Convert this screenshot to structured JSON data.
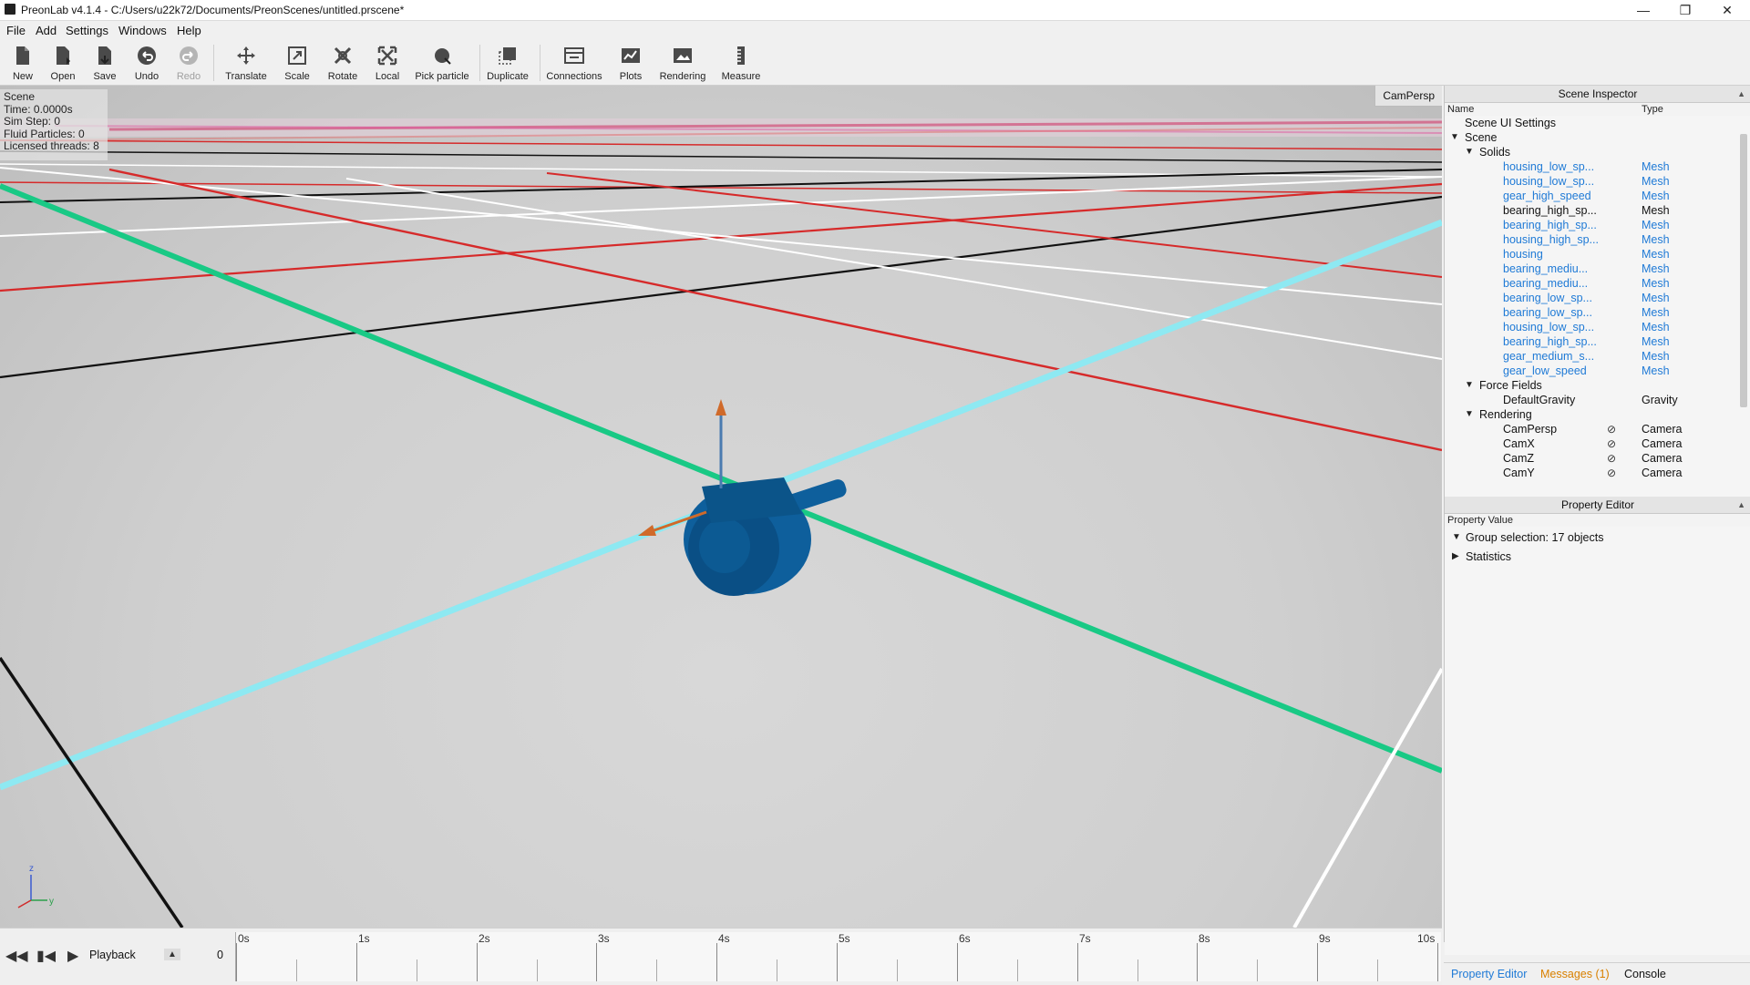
{
  "window": {
    "title": "PreonLab v4.1.4 - C:/Users/u22k72/Documents/PreonScenes/untitled.prscene*",
    "minimize": "—",
    "restore": "❐",
    "close": "✕"
  },
  "menu": [
    "File",
    "Add",
    "Settings",
    "Windows",
    "Help"
  ],
  "toolbar": [
    {
      "label": "New",
      "icon": "new-file-icon"
    },
    {
      "label": "Open",
      "icon": "open-file-icon"
    },
    {
      "label": "Save",
      "icon": "save-icon"
    },
    {
      "label": "Undo",
      "icon": "undo-icon"
    },
    {
      "label": "Redo",
      "icon": "redo-icon"
    },
    {
      "label": "Translate",
      "icon": "translate-icon"
    },
    {
      "label": "Scale",
      "icon": "scale-icon"
    },
    {
      "label": "Rotate",
      "icon": "rotate-icon"
    },
    {
      "label": "Local",
      "icon": "local-icon"
    },
    {
      "label": "Pick particle",
      "icon": "pick-particle-icon"
    },
    {
      "label": "Duplicate",
      "icon": "duplicate-icon"
    },
    {
      "label": "Connections",
      "icon": "connections-icon"
    },
    {
      "label": "Plots",
      "icon": "plots-icon"
    },
    {
      "label": "Rendering",
      "icon": "rendering-icon"
    },
    {
      "label": "Measure",
      "icon": "measure-icon"
    }
  ],
  "viewport": {
    "stats": [
      "Scene",
      "Time: 0.0000s",
      "Sim Step: 0",
      "Fluid Particles: 0",
      "Licensed threads: 8"
    ],
    "camera": "CamPersp",
    "gizmo": {
      "z": "z",
      "y": "y"
    }
  },
  "scene_inspector": {
    "title": "Scene Inspector",
    "col_name": "Name",
    "col_type": "Type",
    "rows": [
      {
        "name": "Scene UI Settings",
        "type": "",
        "level": 1,
        "arrow": "",
        "color": "normal"
      },
      {
        "name": "Scene",
        "type": "",
        "level": 1,
        "arrow": "down",
        "color": "normal"
      },
      {
        "name": "Solids",
        "type": "",
        "level": 2,
        "arrow": "down",
        "color": "normal"
      },
      {
        "name": "housing_low_sp...",
        "type": "Mesh",
        "level": 3,
        "arrow": "",
        "color": "blue"
      },
      {
        "name": "housing_low_sp...",
        "type": "Mesh",
        "level": 3,
        "arrow": "",
        "color": "blue"
      },
      {
        "name": "gear_high_speed",
        "type": "Mesh",
        "level": 3,
        "arrow": "",
        "color": "blue"
      },
      {
        "name": "bearing_high_sp...",
        "type": "Mesh",
        "level": 3,
        "arrow": "",
        "color": "normal"
      },
      {
        "name": "bearing_high_sp...",
        "type": "Mesh",
        "level": 3,
        "arrow": "",
        "color": "blue"
      },
      {
        "name": "housing_high_sp...",
        "type": "Mesh",
        "level": 3,
        "arrow": "",
        "color": "blue"
      },
      {
        "name": "housing",
        "type": "Mesh",
        "level": 3,
        "arrow": "",
        "color": "blue"
      },
      {
        "name": "bearing_mediu...",
        "type": "Mesh",
        "level": 3,
        "arrow": "",
        "color": "blue"
      },
      {
        "name": "bearing_mediu...",
        "type": "Mesh",
        "level": 3,
        "arrow": "",
        "color": "blue"
      },
      {
        "name": "bearing_low_sp...",
        "type": "Mesh",
        "level": 3,
        "arrow": "",
        "color": "blue"
      },
      {
        "name": "bearing_low_sp...",
        "type": "Mesh",
        "level": 3,
        "arrow": "",
        "color": "blue"
      },
      {
        "name": "housing_low_sp...",
        "type": "Mesh",
        "level": 3,
        "arrow": "",
        "color": "blue"
      },
      {
        "name": "bearing_high_sp...",
        "type": "Mesh",
        "level": 3,
        "arrow": "",
        "color": "blue"
      },
      {
        "name": "gear_medium_s...",
        "type": "Mesh",
        "level": 3,
        "arrow": "",
        "color": "blue"
      },
      {
        "name": "gear_low_speed",
        "type": "Mesh",
        "level": 3,
        "arrow": "",
        "color": "blue"
      },
      {
        "name": "Force Fields",
        "type": "",
        "level": 2,
        "arrow": "down",
        "color": "normal"
      },
      {
        "name": "DefaultGravity",
        "type": "Gravity",
        "level": 3,
        "arrow": "",
        "color": "normal"
      },
      {
        "name": "Rendering",
        "type": "",
        "level": 2,
        "arrow": "down",
        "color": "normal"
      },
      {
        "name": "CamPersp",
        "type": "Camera",
        "level": 3,
        "arrow": "",
        "color": "normal",
        "eye": true
      },
      {
        "name": "CamX",
        "type": "Camera",
        "level": 3,
        "arrow": "",
        "color": "normal",
        "eye": true
      },
      {
        "name": "CamZ",
        "type": "Camera",
        "level": 3,
        "arrow": "",
        "color": "normal",
        "eye": true
      },
      {
        "name": "CamY",
        "type": "Camera",
        "level": 3,
        "arrow": "",
        "color": "normal",
        "eye": true
      }
    ]
  },
  "property_editor": {
    "title": "Property Editor",
    "col_label": "Property Value",
    "rows": [
      {
        "label": "Group selection: 17 objects",
        "arrow": "down"
      },
      {
        "label": "Statistics",
        "arrow": "right"
      }
    ]
  },
  "bottom_tabs": {
    "property_editor": "Property Editor",
    "messages": "Messages (1)",
    "console": "Console"
  },
  "timeline": {
    "playback_label": "Playback",
    "frame": "0",
    "ticks": [
      "0s",
      "1s",
      "2s",
      "3s",
      "4s",
      "5s",
      "6s",
      "7s",
      "8s",
      "9s",
      "10s"
    ]
  }
}
